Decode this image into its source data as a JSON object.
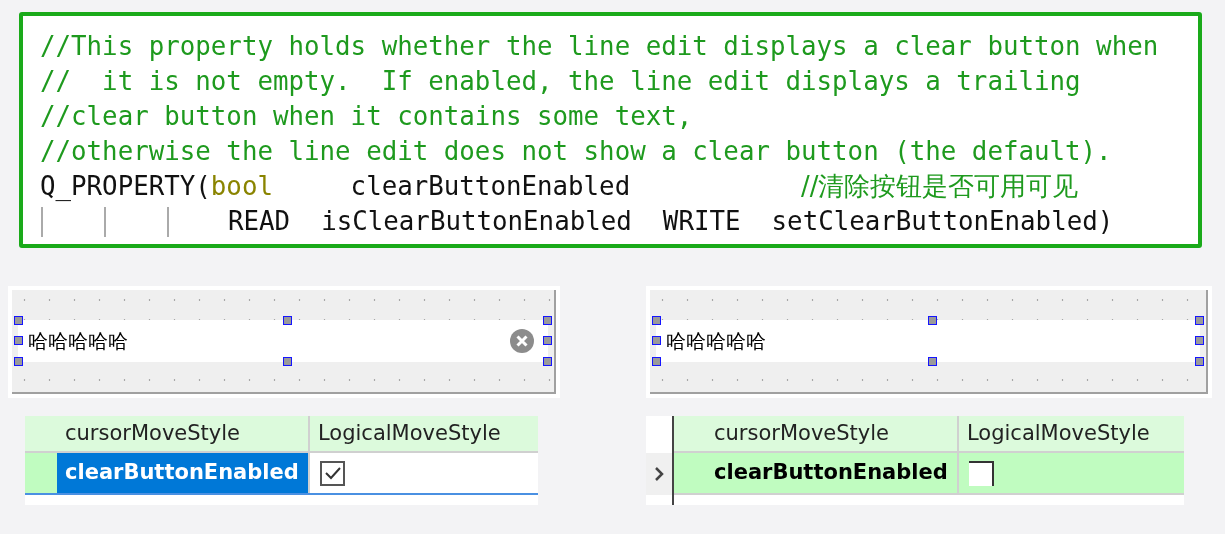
{
  "code": {
    "lines": [
      {
        "indented": false,
        "tokens": [
          {
            "kind": "comment",
            "text": "//This property holds whether the line edit displays a clear button when"
          }
        ]
      },
      {
        "indented": false,
        "tokens": [
          {
            "kind": "comment",
            "text": "//  it is not empty.  If enabled, the line edit displays a trailing"
          }
        ]
      },
      {
        "indented": false,
        "tokens": [
          {
            "kind": "comment",
            "text": "//clear button when it contains some text,"
          }
        ]
      },
      {
        "indented": false,
        "tokens": [
          {
            "kind": "comment",
            "text": "//otherwise the line edit does not show a clear button (the default)."
          }
        ]
      },
      {
        "indented": false,
        "tokens": [
          {
            "kind": "plain",
            "text": "Q_PROPERTY("
          },
          {
            "kind": "type",
            "text": "bool"
          },
          {
            "kind": "plain",
            "text": "     clearButtonEnabled           "
          },
          {
            "kind": "comment",
            "text": "//清除按钮是否可用可见"
          }
        ]
      },
      {
        "indented": true,
        "tokens": [
          {
            "kind": "plain",
            "text": "READ  isClearButtonEnabled  WRITE  setClearButtonEnabled)"
          }
        ]
      }
    ]
  },
  "designers": [
    {
      "line_edit": {
        "value": "哈哈哈哈哈",
        "clear_button": true
      },
      "property_editor": {
        "header": {
          "name": "cursorMoveStyle",
          "value": "LogicalMoveStyle"
        },
        "row": {
          "name": "clearButtonEnabled",
          "checked": true,
          "selected": true,
          "current": false
        }
      }
    },
    {
      "line_edit": {
        "value": "哈哈哈哈哈",
        "clear_button": false
      },
      "property_editor": {
        "header": {
          "name": "cursorMoveStyle",
          "value": "LogicalMoveStyle"
        },
        "row": {
          "name": "clearButtonEnabled",
          "checked": false,
          "selected": false,
          "current": true
        }
      }
    }
  ]
}
